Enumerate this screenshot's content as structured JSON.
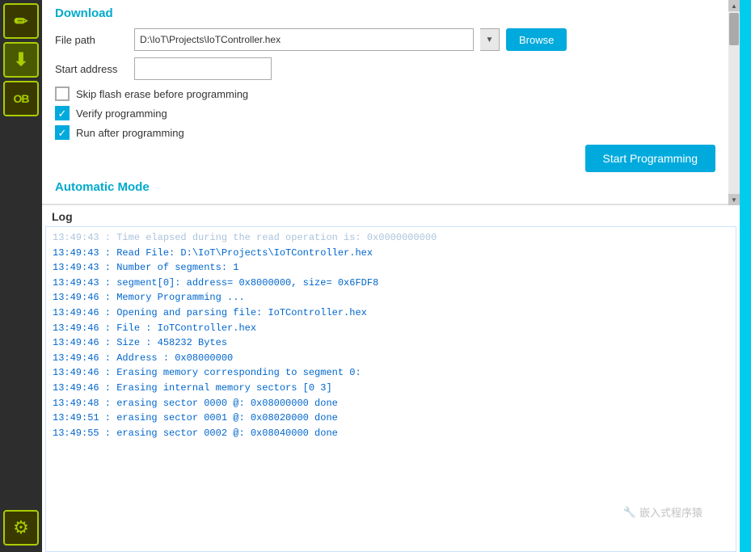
{
  "sidebar": {
    "buttons": [
      {
        "id": "pencil-btn",
        "icon": "✏️",
        "label": "Edit"
      },
      {
        "id": "download-btn",
        "icon": "⬇",
        "label": "Download"
      },
      {
        "id": "ob-btn",
        "icon": "OB",
        "label": "Option Bytes"
      }
    ],
    "bottom_btn": {
      "id": "gear-btn",
      "icon": "⚙",
      "label": "Settings"
    }
  },
  "download": {
    "title": "Download",
    "file_path_label": "File path",
    "file_path_value": "D:\\IoT\\Projects\\IoTController.hex",
    "browse_label": "Browse",
    "start_address_label": "Start address",
    "start_address_value": "",
    "skip_flash_label": "Skip flash erase before programming",
    "skip_flash_checked": false,
    "verify_label": "Verify programming",
    "verify_checked": true,
    "run_after_label": "Run after programming",
    "run_after_checked": true,
    "start_programming_label": "Start Programming"
  },
  "automatic_mode": {
    "title": "Automatic Mode"
  },
  "log": {
    "title": "Log",
    "lines": [
      "13:49:43  : Time elapsed during the read operation is: 0x0000000000",
      "13:49:43  : Read File: D:\\IoT\\Projects\\IoTController.hex",
      "13:49:43  : Number of segments: 1",
      "13:49:43  : segment[0]: address= 0x8000000,  size= 0x6FDF8",
      "13:49:46  : Memory Programming ...",
      "13:49:46  : Opening and parsing file: IoTController.hex",
      "13:49:46  : File : IoTController.hex",
      "13:49:46  : Size : 458232 Bytes",
      "13:49:46  : Address : 0x08000000",
      "13:49:46  : Erasing memory corresponding to segment 0:",
      "13:49:46  : Erasing internal memory sectors [0 3]",
      "13:49:48  : erasing sector 0000 @: 0x08000000 done",
      "13:49:51  : erasing sector 0001 @: 0x08020000 done",
      "13:49:55  : erasing sector 0002 @: 0x08040000 done"
    ],
    "first_line_faded": true
  },
  "watermark": {
    "text": "嵌入式程序猿",
    "icon": "🔧"
  }
}
